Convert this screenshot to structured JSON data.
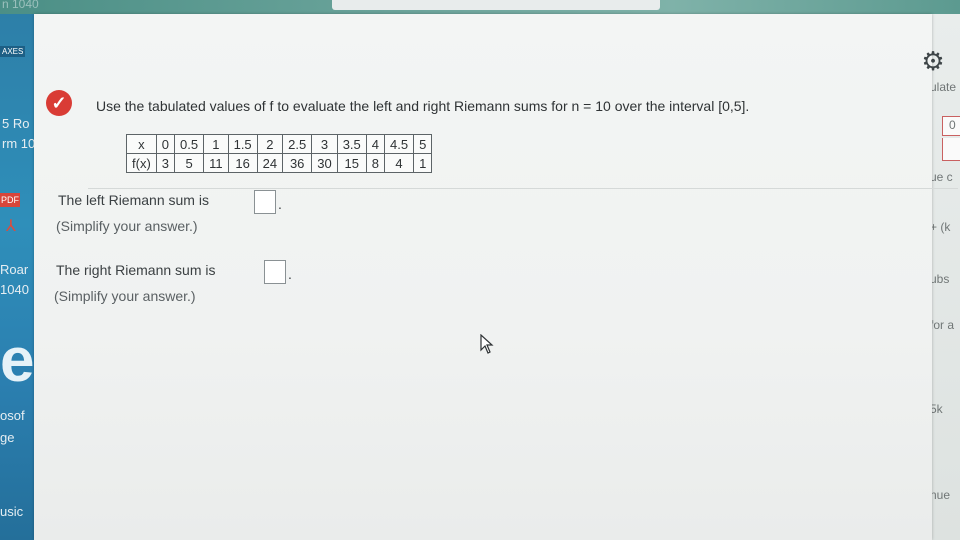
{
  "background": {
    "top_left_text": "n 1040",
    "left_texts": [
      "5 Ro",
      "rm 10",
      "Roar",
      "1040",
      "osof",
      "ge",
      "usic"
    ],
    "left_badge": "AXES",
    "pdf_badge": "PDF",
    "right_texts": [
      "ulate",
      "0",
      "ue c",
      "+ (k",
      "ubs",
      "for a",
      "5k",
      "nue"
    ]
  },
  "question": {
    "text": "Use the tabulated values of f to evaluate the left and right Riemann sums for n = 10 over the interval [0,5]."
  },
  "table": {
    "x_label": "x",
    "fx_label": "f(x)",
    "x_values": [
      "0",
      "0.5",
      "1",
      "1.5",
      "2",
      "2.5",
      "3",
      "3.5",
      "4",
      "4.5",
      "5"
    ],
    "fx_values": [
      "3",
      "5",
      "11",
      "16",
      "24",
      "36",
      "30",
      "15",
      "8",
      "4",
      "1"
    ]
  },
  "left_sum": {
    "prompt": "The left Riemann sum is",
    "value": "",
    "hint": "(Simplify your answer.)"
  },
  "right_sum": {
    "prompt": "The right Riemann sum is",
    "value": "",
    "hint": "(Simplify your answer.)"
  },
  "icons": {
    "settings": "gear-icon",
    "status": "check-icon"
  },
  "colors": {
    "status_red": "#d93c35",
    "card": "#f3f5f4"
  }
}
